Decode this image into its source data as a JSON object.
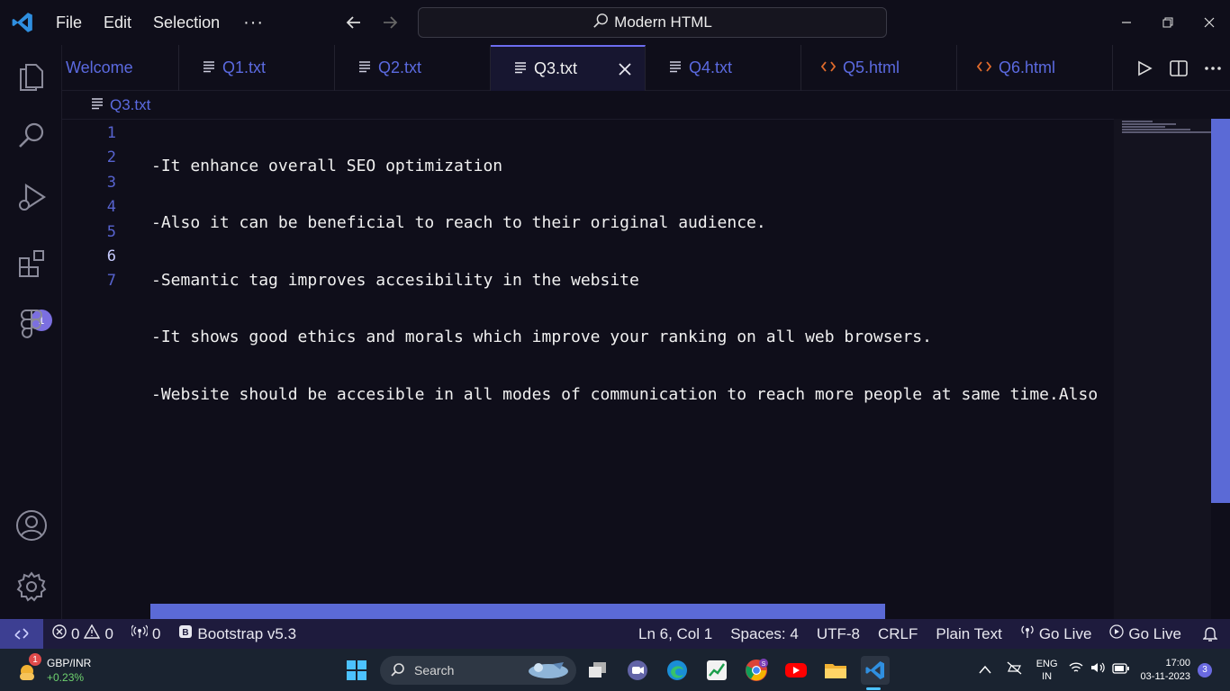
{
  "titlebar": {
    "menu": [
      "File",
      "Edit",
      "Selection"
    ],
    "more": "···",
    "command_center": "Modern HTML"
  },
  "activity_bar": {
    "items": [
      "explorer-icon",
      "search-icon",
      "run-debug-icon",
      "extensions-icon",
      "figma-icon"
    ],
    "extensions_badge": "1",
    "bottom": [
      "account-icon",
      "gear-icon"
    ]
  },
  "tabs": [
    {
      "label": "Welcome",
      "icon": "none",
      "active": false
    },
    {
      "label": "Q1.txt",
      "icon": "lines-icon",
      "active": false
    },
    {
      "label": "Q2.txt",
      "icon": "lines-icon",
      "active": false
    },
    {
      "label": "Q3.txt",
      "icon": "lines-icon",
      "active": true
    },
    {
      "label": "Q4.txt",
      "icon": "lines-icon",
      "active": false
    },
    {
      "label": "Q5.html",
      "icon": "html-icon",
      "active": false
    },
    {
      "label": "Q6.html",
      "icon": "html-icon",
      "active": false
    }
  ],
  "breadcrumb": {
    "file": "Q3.txt"
  },
  "editor": {
    "current_line": 6,
    "line_numbers": [
      "1",
      "2",
      "3",
      "4",
      "5",
      "6",
      "7"
    ],
    "lines": [
      "-It enhance overall SEO optimization",
      "-Also it can be beneficial to reach to their original audience.",
      "-Semantic tag improves accesibility in the website",
      "-It shows good ethics and morals which improve your ranking on all web browsers.",
      "-Website should be accesible in all modes of communication to reach more people at same time.Also",
      "",
      ""
    ]
  },
  "statusbar": {
    "errors": "0",
    "warnings": "0",
    "ports": "0",
    "bootstrap": "Bootstrap v5.3",
    "position": "Ln 6, Col 1",
    "spaces": "Spaces: 4",
    "encoding": "UTF-8",
    "eol": "CRLF",
    "language": "Plain Text",
    "go_live_1": "Go Live",
    "go_live_2": "Go Live"
  },
  "taskbar": {
    "widget_title": "GBP/INR",
    "widget_value": "+0.23%",
    "widget_badge": "1",
    "search_label": "Search",
    "lang_line1": "ENG",
    "lang_line2": "IN",
    "time": "17:00",
    "date": "03-11-2023",
    "notifications": "3"
  },
  "colors": {
    "accent": "#5b6ae0",
    "background": "#0f0e1a",
    "statusbar": "#1e1b3d",
    "taskbar": "#1a2330"
  }
}
